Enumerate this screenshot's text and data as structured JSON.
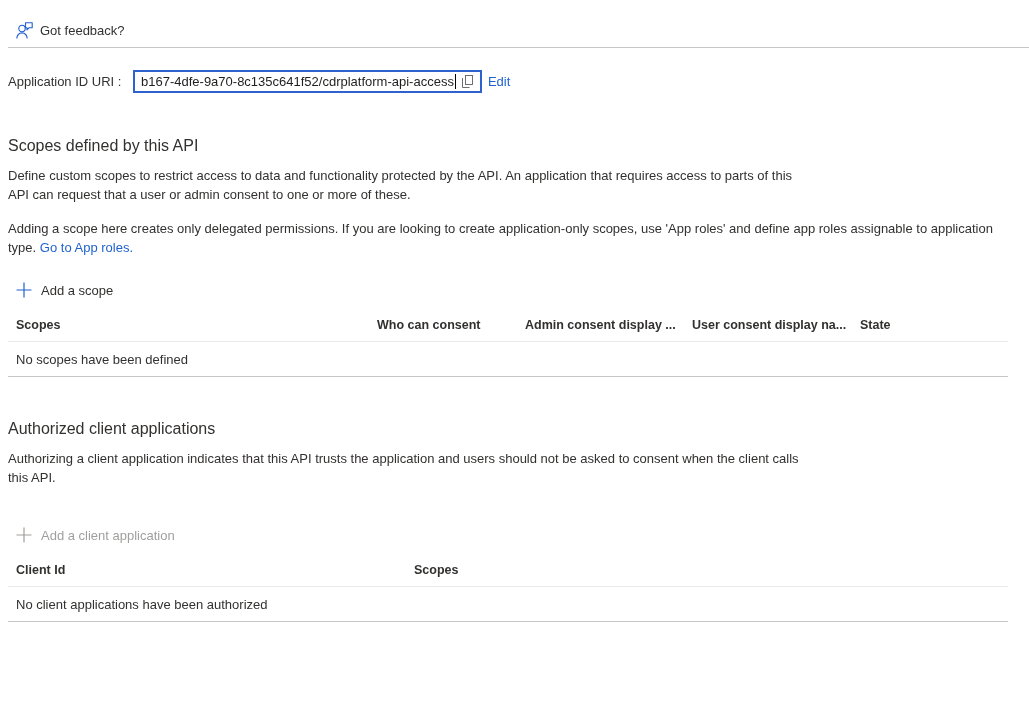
{
  "feedback": {
    "label": "Got feedback?"
  },
  "application_id_uri": {
    "label": "Application ID URI :",
    "value": "b167-4dfe-9a70-8c135c641f52/cdrplatform-api-access",
    "focused": true,
    "edit_link": "Edit"
  },
  "sections": [
    {
      "title": "Scopes defined by this API",
      "paragraphs": [
        {
          "text": "Define custom scopes to restrict access to data and functionality protected by the API. An application that requires access to parts of this API can request that a user or admin consent to one or more of these."
        },
        {
          "text": "Adding a scope here creates only delegated permissions. If you are looking to create application-only scopes, use 'App roles' and define app roles assignable to application type.",
          "link": "Go to App roles."
        }
      ],
      "add_action": {
        "label": "Add a scope",
        "disabled": false
      },
      "table": {
        "columns": [
          "Scopes",
          "Who can consent",
          "Admin consent display ...",
          "User consent display na...",
          "State"
        ],
        "empty_message": "No scopes have been defined"
      }
    },
    {
      "title": "Authorized client applications",
      "paragraphs": [
        {
          "text": "Authorizing a client application indicates that this API trusts the application and users should not be asked to consent when the client calls this API."
        }
      ],
      "add_action": {
        "label": "Add a client application",
        "disabled": true
      },
      "table": {
        "columns": [
          "Client Id",
          "Scopes"
        ],
        "empty_message": "No client applications have been authorized"
      }
    }
  ]
}
